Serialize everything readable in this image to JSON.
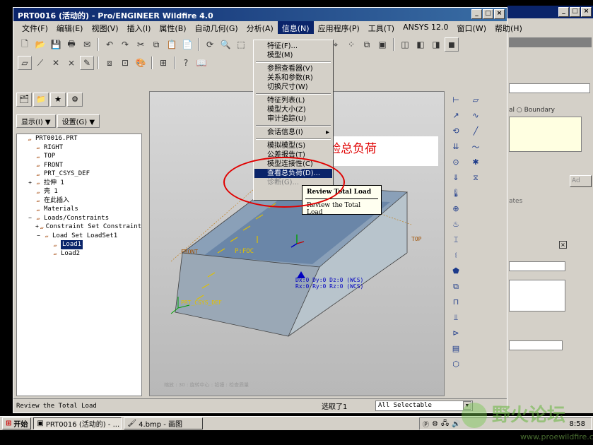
{
  "window": {
    "title": "PRT0016 (活动的) - Pro/ENGINEER Wildfire 4.0",
    "controls": [
      "_",
      "□",
      "×"
    ]
  },
  "menubar": {
    "items": [
      {
        "label": "文件(F)"
      },
      {
        "label": "编辑(E)"
      },
      {
        "label": "视图(V)"
      },
      {
        "label": "插入(I)"
      },
      {
        "label": "属性(B)"
      },
      {
        "label": "自动几何(G)"
      },
      {
        "label": "分析(A)"
      },
      {
        "label": "信息(N)"
      },
      {
        "label": "应用程序(P)"
      },
      {
        "label": "工具(T)"
      },
      {
        "label": "ANSYS 12.0"
      },
      {
        "label": "窗口(W)"
      },
      {
        "label": "帮助(H)"
      }
    ]
  },
  "info_menu": {
    "items": [
      {
        "label": "特征(F)...",
        "enabled": true
      },
      {
        "label": "模型(M)",
        "enabled": true
      },
      {
        "sep": true
      },
      {
        "label": "参照查看器(V)",
        "enabled": true
      },
      {
        "label": "关系和参数(R)",
        "enabled": true
      },
      {
        "label": "切换尺寸(W)",
        "enabled": true
      },
      {
        "sep": true
      },
      {
        "label": "特征列表(L)",
        "enabled": true
      },
      {
        "label": "模型大小(Z)",
        "enabled": true
      },
      {
        "label": "审计追踪(U)",
        "enabled": true
      },
      {
        "sep": true
      },
      {
        "label": "会话信息(I)",
        "enabled": true,
        "submenu": true
      },
      {
        "sep": true
      },
      {
        "label": "模拟模型(S)",
        "enabled": true
      },
      {
        "label": "公差报告(T)",
        "enabled": true
      },
      {
        "label": "模型连接性(C)",
        "enabled": true
      },
      {
        "label": "查看总负荷(D)...",
        "enabled": true,
        "highlighted": true
      },
      {
        "label": "诊断(G)...",
        "enabled": false
      }
    ]
  },
  "tooltip": {
    "title": "Review Total Load",
    "description": "Review the Total Load"
  },
  "callout": {
    "text": "校验总负荷"
  },
  "left_panel": {
    "show_menu": "显示(I) ▼",
    "settings_menu": "设置(G) ▼"
  },
  "model_tree": {
    "items": [
      {
        "label": "PRT0016.PRT",
        "indent": 0,
        "icon": "part-icon"
      },
      {
        "label": "RIGHT",
        "indent": 1,
        "icon": "datum-plane-icon"
      },
      {
        "label": "TOP",
        "indent": 1,
        "icon": "datum-plane-icon"
      },
      {
        "label": "FRONT",
        "indent": 1,
        "icon": "datum-plane-icon"
      },
      {
        "label": "PRT_CSYS_DEF",
        "indent": 1,
        "icon": "csys-icon"
      },
      {
        "label": "拉伸 1",
        "indent": 1,
        "icon": "extrude-icon",
        "expand": "+"
      },
      {
        "label": "壳 1",
        "indent": 1,
        "icon": "shell-icon"
      },
      {
        "label": "在此插入",
        "indent": 1,
        "icon": "insert-arrow-icon"
      },
      {
        "label": "Materials",
        "indent": 1,
        "icon": "materials-icon"
      },
      {
        "label": "Loads/Constraints",
        "indent": 1,
        "icon": "loads-icon",
        "expand": "−"
      },
      {
        "label": "Constraint Set ConstraintSe",
        "indent": 2,
        "icon": "constraint-icon",
        "expand": "+"
      },
      {
        "label": "Load Set LoadSet1",
        "indent": 2,
        "icon": "loadset-icon",
        "expand": "−"
      },
      {
        "label": "Load1",
        "indent": 3,
        "icon": "load-icon",
        "selected": true
      },
      {
        "label": "Load2",
        "indent": 3,
        "icon": "load-icon"
      }
    ]
  },
  "viewport": {
    "labels": {
      "front": "FRONT",
      "top": "TOP",
      "pfoc": "P:FOC",
      "csys": "PRT_CSYS_DEF",
      "disp": "Dx:0 Dy:0 Dz:0 (WCS)",
      "rot": "Rx:0 Ry:0 Rz:0 (WCS)"
    },
    "footer": "缩放 : 30 : 旋转中心 : 铅锤 : 检查质量"
  },
  "status_bar": {
    "message": "Review the Total Load",
    "selected": "选取了1",
    "filter": "All Selectable"
  },
  "background_window": {
    "radio_label": "al",
    "boundary": "Boundary",
    "add": "Ad",
    "rates": "ates"
  },
  "taskbar": {
    "start": "开始",
    "tasks": [
      "PRT0016 (活动的) - ...",
      "4.bmp - 画图"
    ],
    "clock": "8:58"
  },
  "watermark": {
    "title": "野火论坛",
    "url": "www.proewildfire.cn"
  }
}
